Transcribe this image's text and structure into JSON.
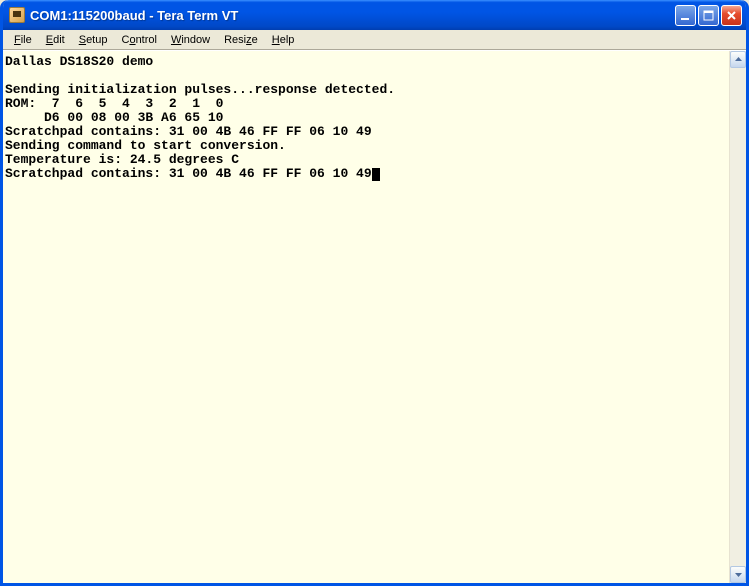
{
  "window": {
    "title": "COM1:115200baud - Tera Term VT"
  },
  "menu": {
    "file": "File",
    "edit": "Edit",
    "setup": "Setup",
    "control": "Control",
    "window": "Window",
    "resize": "Resize",
    "help": "Help"
  },
  "terminal": {
    "lines": [
      "Dallas DS18S20 demo",
      "",
      "Sending initialization pulses...response detected.",
      "ROM:  7  6  5  4  3  2  1  0",
      "     D6 00 08 00 3B A6 65 10",
      "Scratchpad contains: 31 00 4B 46 FF FF 06 10 49",
      "Sending command to start conversion.",
      "Temperature is: 24.5 degrees C",
      "Scratchpad contains: 31 00 4B 46 FF FF 06 10 49"
    ]
  }
}
